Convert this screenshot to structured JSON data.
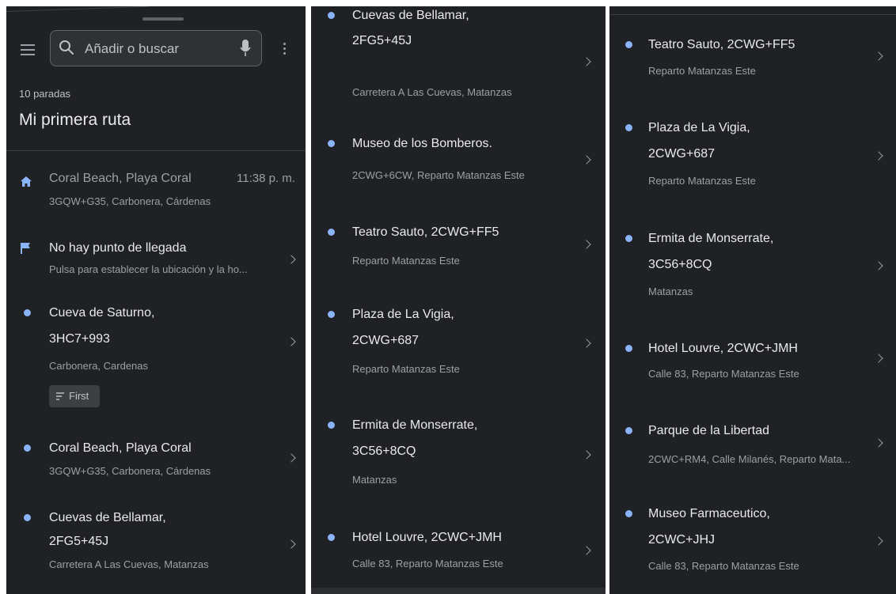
{
  "search": {
    "placeholder": "Añadir o buscar"
  },
  "route": {
    "stops_count": "10 paradas",
    "title": "Mi primera ruta"
  },
  "colors": {
    "background": "#202124",
    "accent": "#8ab4f8",
    "text": "#e8eaed",
    "subtext": "#9aa0a6"
  },
  "icons": {
    "menu": "hamburger-menu-icon",
    "search": "search-icon",
    "mic": "microphone-icon",
    "more": "more-vert-icon",
    "home": "home-icon",
    "flag": "flag-icon",
    "stop": "dot-icon",
    "open": "chevron-right-icon",
    "priority": "priority-lines-icon"
  },
  "panel1": {
    "start": {
      "title": "Coral Beach, Playa Coral",
      "time": "11:38 p. m.",
      "subtitle": "3GQW+G35, Carbonera, Cárdenas"
    },
    "end": {
      "title": "No hay punto de llegada",
      "subtitle": "Pulsa para establecer la ubicación y la ho..."
    },
    "stops": [
      {
        "title_line1": "Cueva de Saturno,",
        "title_line2": "3HC7+993",
        "subtitle": "Carbonera, Cardenas",
        "chip": "First"
      },
      {
        "title_line1": "Coral Beach, Playa Coral",
        "subtitle": "3GQW+G35, Carbonera, Cárdenas"
      },
      {
        "title_line1": "Cuevas de Bellamar,",
        "title_line2": "2FG5+45J",
        "subtitle": "Carretera A Las Cuevas, Matanzas"
      }
    ]
  },
  "panel2": {
    "stops": [
      {
        "title_line1": "Cuevas de Bellamar,",
        "title_line2": "2FG5+45J",
        "subtitle": "Carretera A Las Cuevas, Matanzas"
      },
      {
        "title_line1": "Museo de los Bomberos.",
        "subtitle": "2CWG+6CW, Reparto Matanzas Este"
      },
      {
        "title_line1": "Teatro Sauto, 2CWG+FF5",
        "subtitle": "Reparto Matanzas Este"
      },
      {
        "title_line1": "Plaza de La Vigia,",
        "title_line2": "2CWG+687",
        "subtitle": "Reparto Matanzas Este"
      },
      {
        "title_line1": "Ermita de Monserrate,",
        "title_line2": "3C56+8CQ",
        "subtitle": "Matanzas"
      },
      {
        "title_line1": "Hotel Louvre, 2CWC+JMH",
        "subtitle": "Calle 83, Reparto Matanzas Este"
      }
    ]
  },
  "panel3": {
    "stops": [
      {
        "title_line1": "Teatro Sauto, 2CWG+FF5",
        "subtitle": "Reparto Matanzas Este"
      },
      {
        "title_line1": "Plaza de La Vigia,",
        "title_line2": "2CWG+687",
        "subtitle": "Reparto Matanzas Este"
      },
      {
        "title_line1": "Ermita de Monserrate,",
        "title_line2": "3C56+8CQ",
        "subtitle": "Matanzas"
      },
      {
        "title_line1": "Hotel Louvre, 2CWC+JMH",
        "subtitle": "Calle 83, Reparto Matanzas Este"
      },
      {
        "title_line1": "Parque de la Libertad",
        "subtitle": "2CWC+RM4, Calle Milanés, Reparto Mata..."
      },
      {
        "title_line1": "Museo Farmaceutico,",
        "title_line2": "2CWC+JHJ",
        "subtitle": "Calle 83, Reparto Matanzas Este"
      }
    ]
  }
}
